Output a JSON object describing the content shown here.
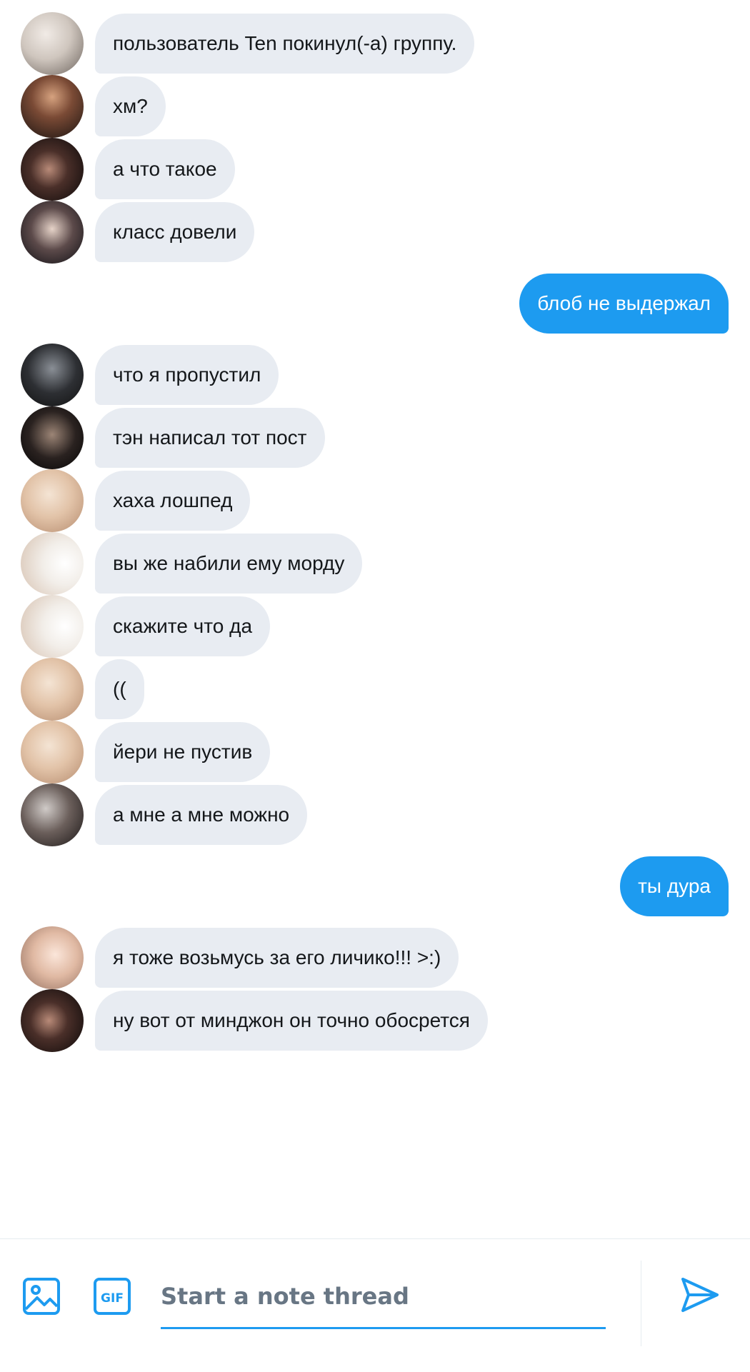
{
  "colors": {
    "accent": "#1d9bf0",
    "incoming_bubble": "#e8ecf2",
    "placeholder": "#687684"
  },
  "messages": [
    {
      "direction": "in",
      "text": "пользователь Ten покинул(-а) группу.",
      "avatar": "avatar-1"
    },
    {
      "direction": "in",
      "text": "хм?",
      "avatar": "avatar-2"
    },
    {
      "direction": "in",
      "text": "а что такое",
      "avatar": "avatar-3"
    },
    {
      "direction": "in",
      "text": "класс довели",
      "avatar": "avatar-4"
    },
    {
      "direction": "out",
      "text": "блоб не выдержал"
    },
    {
      "direction": "in",
      "text": "что я пропустил",
      "avatar": "avatar-5"
    },
    {
      "direction": "in",
      "text": "тэн написал тот пост",
      "avatar": "avatar-6"
    },
    {
      "direction": "in",
      "text": "хаха лошпед",
      "avatar": "avatar-7"
    },
    {
      "direction": "in",
      "text": "вы же набили ему морду",
      "avatar": "avatar-8"
    },
    {
      "direction": "in",
      "text": "скажите что да",
      "avatar": "avatar-8"
    },
    {
      "direction": "in",
      "text": "((",
      "avatar": "avatar-7"
    },
    {
      "direction": "in",
      "text": "йери не пустив",
      "avatar": "avatar-7"
    },
    {
      "direction": "in",
      "text": "а мне а мне можно",
      "avatar": "avatar-9"
    },
    {
      "direction": "out",
      "text": "ты дура"
    },
    {
      "direction": "in",
      "text": "я тоже возьмусь за его личико!!! >:)",
      "avatar": "avatar-10"
    },
    {
      "direction": "in",
      "text": "ну вот от минджон он точно обосрется",
      "avatar": "avatar-3"
    }
  ],
  "composer": {
    "image_icon": "image-icon",
    "gif_icon": "gif-icon",
    "gif_label": "GIF",
    "placeholder": "Start a note thread",
    "value": "",
    "send_icon": "send-icon"
  }
}
